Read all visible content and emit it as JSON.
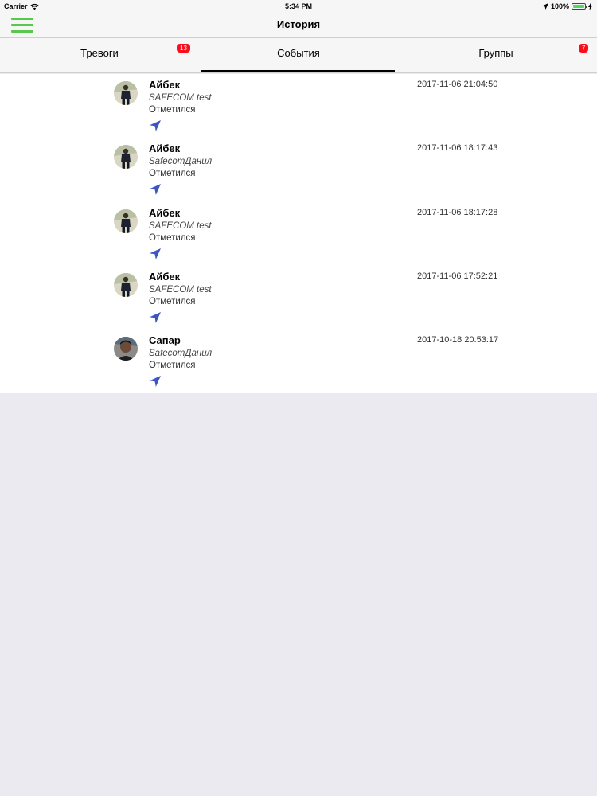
{
  "status_bar": {
    "carrier": "Carrier",
    "time": "5:34 PM",
    "battery": "100%"
  },
  "nav": {
    "title": "История",
    "menu_icon": "hamburger-menu-icon",
    "menu_color": "#57c84a"
  },
  "tabs": [
    {
      "label": "Тревоги",
      "badge": "13"
    },
    {
      "label": "События",
      "badge": ""
    },
    {
      "label": "Группы",
      "badge": "7"
    }
  ],
  "colors": {
    "badge": "#fc0d1b",
    "location_icon": "#3b55c7",
    "battery": "#4cd964"
  },
  "events": [
    {
      "name": "Айбек",
      "group": "SAFECOM test",
      "action": "Отметился",
      "time": "2017-11-06 21:04:50",
      "icon": "location-arrow-icon"
    },
    {
      "name": "Айбек",
      "group": "SafecomДанил",
      "action": "Отметился",
      "time": "2017-11-06 18:17:43",
      "icon": "location-arrow-icon"
    },
    {
      "name": "Айбек",
      "group": "SAFECOM test",
      "action": "Отметился",
      "time": "2017-11-06 18:17:28",
      "icon": "location-arrow-icon"
    },
    {
      "name": "Айбек",
      "group": "SAFECOM test",
      "action": "Отметился",
      "time": "2017-11-06 17:52:21",
      "icon": "location-arrow-icon"
    },
    {
      "name": "Сапар",
      "group": "SafecomДанил",
      "action": "Отметился",
      "time": "2017-10-18 20:53:17",
      "icon": "location-arrow-icon"
    }
  ]
}
